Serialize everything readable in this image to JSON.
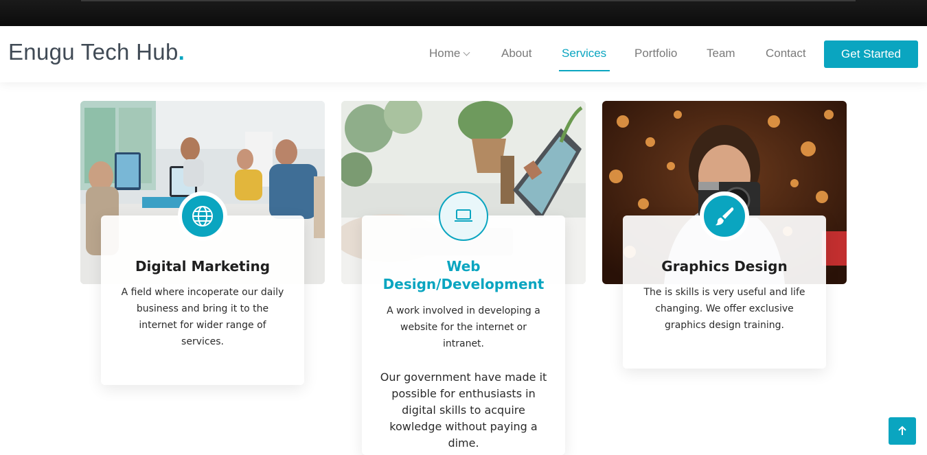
{
  "header": {
    "logo_text": "Enugu Tech Hub",
    "logo_dot": ".",
    "nav": [
      {
        "label": "Home",
        "has_dropdown": true
      },
      {
        "label": "About"
      },
      {
        "label": "Services",
        "active": true
      },
      {
        "label": "Portfolio"
      },
      {
        "label": "Team"
      },
      {
        "label": "Contact"
      }
    ],
    "cta_label": "Get Started"
  },
  "services": [
    {
      "icon": "globe-icon",
      "title": "Digital Marketing",
      "description": "A field where incoperate our daily business and bring it to the internet for wider range of services."
    },
    {
      "icon": "laptop-icon",
      "title": "Web Design/Development",
      "description": "A work involved in developing a website for the internet or intranet.",
      "extra": "Our government have made it possible for enthusiasts in digital skills to acquire kowledge without paying a dime."
    },
    {
      "icon": "brush-icon",
      "title": "Graphics Design",
      "description": "The is skills is very useful and life changing. We offer exclusive graphics design training."
    }
  ],
  "colors": {
    "accent": "#0aa5c0",
    "text": "#222222",
    "nav_text": "#7a7a7a"
  },
  "back_to_top_icon": "arrow-up-icon"
}
